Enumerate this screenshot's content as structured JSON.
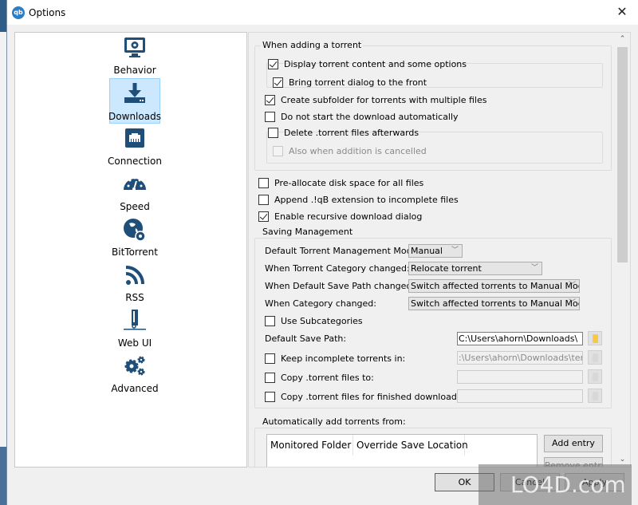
{
  "window": {
    "title": "Options",
    "app_icon_text": "qb",
    "close_glyph": "✕"
  },
  "sidebar": {
    "selected": "Downloads",
    "items": [
      {
        "label": "Behavior",
        "icon": "monitor-gear-icon"
      },
      {
        "label": "Downloads",
        "icon": "download-icon"
      },
      {
        "label": "Connection",
        "icon": "ethernet-port-icon"
      },
      {
        "label": "Speed",
        "icon": "speedometer-icon"
      },
      {
        "label": "BitTorrent",
        "icon": "globe-gear-icon"
      },
      {
        "label": "RSS",
        "icon": "rss-icon"
      },
      {
        "label": "Web UI",
        "icon": "web-server-icon"
      },
      {
        "label": "Advanced",
        "icon": "gears-icon"
      }
    ],
    "selected_bg": "#cce8ff",
    "icon_color": "#1f4e79"
  },
  "adding": {
    "title": "When adding a torrent",
    "display_content": {
      "label": "Display torrent content and some options",
      "checked": true
    },
    "bring_front": {
      "label": "Bring torrent dialog to the front",
      "checked": true
    },
    "create_subfolder": {
      "label": "Create subfolder for torrents with multiple files",
      "checked": true
    },
    "no_autostart": {
      "label": "Do not start the download automatically",
      "checked": false
    },
    "delete_torrent": {
      "label": "Delete .torrent files afterwards",
      "checked": false
    },
    "also_cancelled": {
      "label": "Also when addition is cancelled",
      "checked": false,
      "disabled": true
    }
  },
  "general": {
    "preallocate": {
      "label": "Pre-allocate disk space for all files",
      "checked": false
    },
    "append_ext": {
      "label": "Append .!qB extension to incomplete files",
      "checked": false
    },
    "recursive": {
      "label": "Enable recursive download dialog",
      "checked": true
    }
  },
  "saving": {
    "title": "Saving Management",
    "mode_label": "Default Torrent Management Mode:",
    "mode_value": "Manual",
    "category_changed_label": "When Torrent Category changed:",
    "category_changed_value": "Relocate torrent",
    "default_path_changed_label": "When Default Save Path changed:",
    "default_path_changed_value": "Switch affected torrents to Manual Mode",
    "cat_changed_label": "When Category changed:",
    "cat_changed_value": "Switch affected torrents to Manual Mode",
    "subcategories": {
      "label": "Use Subcategories",
      "checked": false
    },
    "default_save_label": "Default Save Path:",
    "default_save_value": "C:\\Users\\ahorn\\Downloads\\",
    "keep_incomplete": {
      "label": "Keep incomplete torrents in:",
      "checked": false,
      "value": ":\\Users\\ahorn\\Downloads\\temp\\"
    },
    "copy_torrent": {
      "label": "Copy .torrent files to:",
      "checked": false,
      "value": ""
    },
    "copy_finished": {
      "label": "Copy .torrent files for finished downloads to:",
      "checked": false,
      "value": ""
    },
    "arrow_glyph": "﹀"
  },
  "auto_add": {
    "title": "Automatically add torrents from:",
    "columns": [
      "Monitored Folder",
      "Override Save Location"
    ],
    "add_entry": "Add entry",
    "remove_entry": "Remove entry"
  },
  "scrollbar": {
    "up_glyph": "⌃",
    "down_glyph": "⌄"
  },
  "footer": {
    "ok": "OK",
    "cancel": "Cancel",
    "apply": "Apply"
  },
  "watermark": "LO4D.com"
}
